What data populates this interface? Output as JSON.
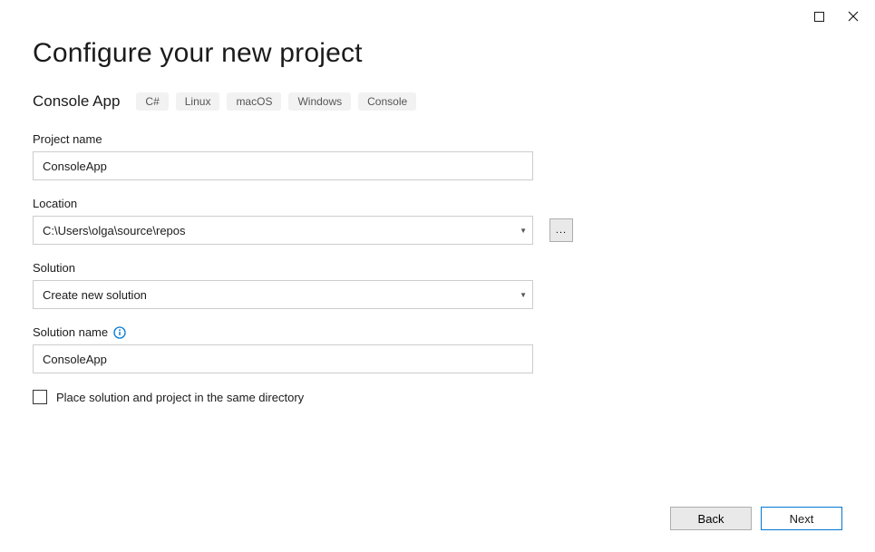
{
  "titlebar": {
    "maximize": "▢",
    "close": "✕"
  },
  "header": {
    "title": "Configure your new project",
    "template": "Console App",
    "tags": [
      "C#",
      "Linux",
      "macOS",
      "Windows",
      "Console"
    ]
  },
  "fields": {
    "project_name": {
      "label": "Project name",
      "value": "ConsoleApp"
    },
    "location": {
      "label": "Location",
      "value": "C:\\Users\\olga\\source\\repos",
      "browse": "..."
    },
    "solution": {
      "label": "Solution",
      "value": "Create new solution"
    },
    "solution_name": {
      "label": "Solution name",
      "value": "ConsoleApp"
    },
    "same_dir": {
      "label": "Place solution and project in the same directory",
      "checked": false
    }
  },
  "footer": {
    "back": "Back",
    "next": "Next"
  }
}
